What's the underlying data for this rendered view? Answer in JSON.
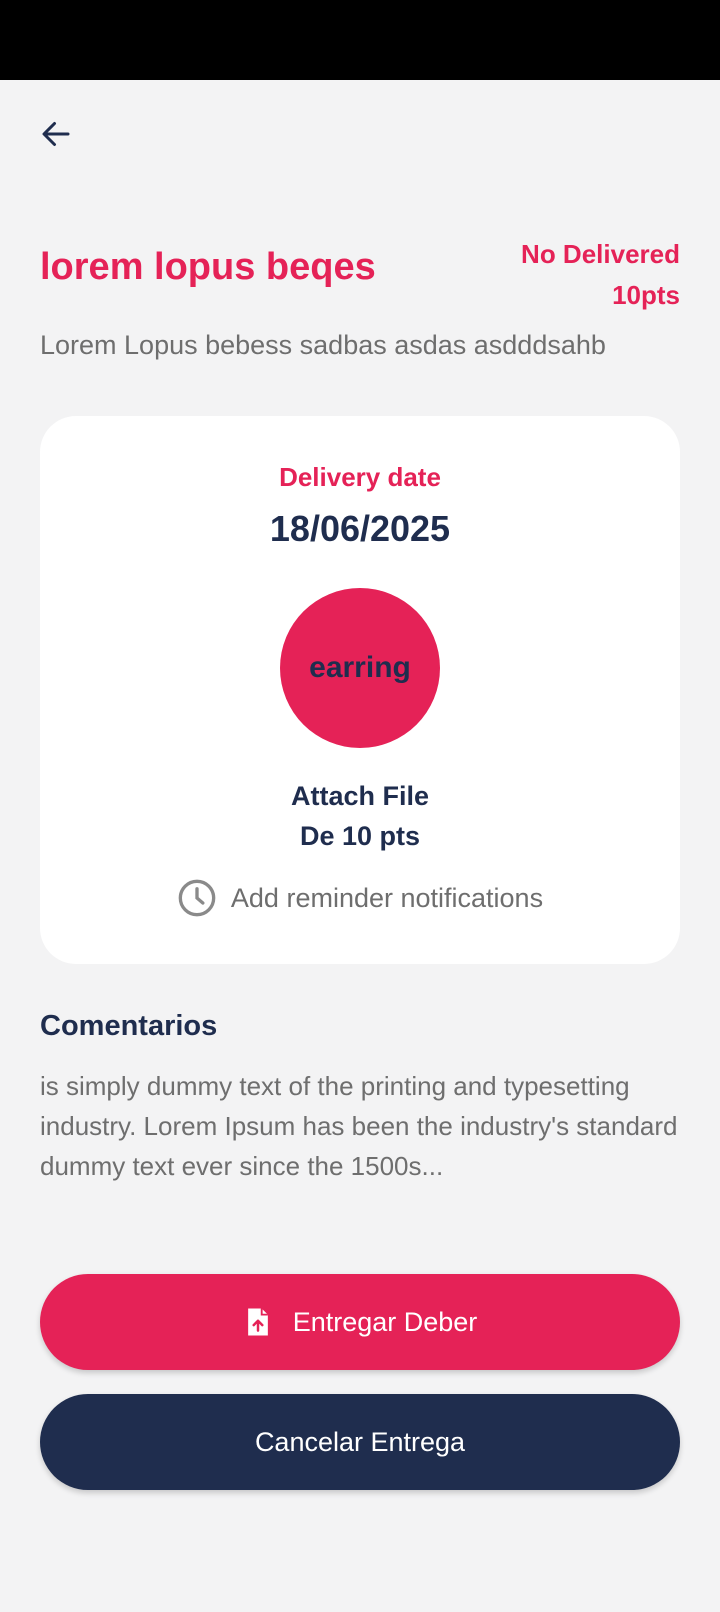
{
  "header": {
    "title": "lorem lopus beqes",
    "status": "No Delivered",
    "points": "10pts",
    "subtitle": "Lorem Lopus bebess sadbas asdas asdddsahb"
  },
  "card": {
    "delivery_label": "Delivery date",
    "delivery_date": "18/06/2025",
    "status_circle": "earring",
    "attach_label": "Attach File",
    "attach_points": "De 10 pts",
    "reminder_label": "Add reminder notifications"
  },
  "comments": {
    "heading": "Comentarios",
    "body": "is simply dummy text of the printing and typesetting industry. Lorem Ipsum has been the industry's standard dummy text ever since the 1500s..."
  },
  "actions": {
    "submit_label": "Entregar Deber",
    "cancel_label": "Cancelar Entrega"
  },
  "icons": {
    "back": "arrow-left-icon",
    "reminder": "clock-icon",
    "submit": "file-upload-icon"
  },
  "colors": {
    "accent": "#e52257",
    "navy": "#1f2d4e",
    "muted_text": "#6e6e6e",
    "background": "#f3f3f4"
  }
}
